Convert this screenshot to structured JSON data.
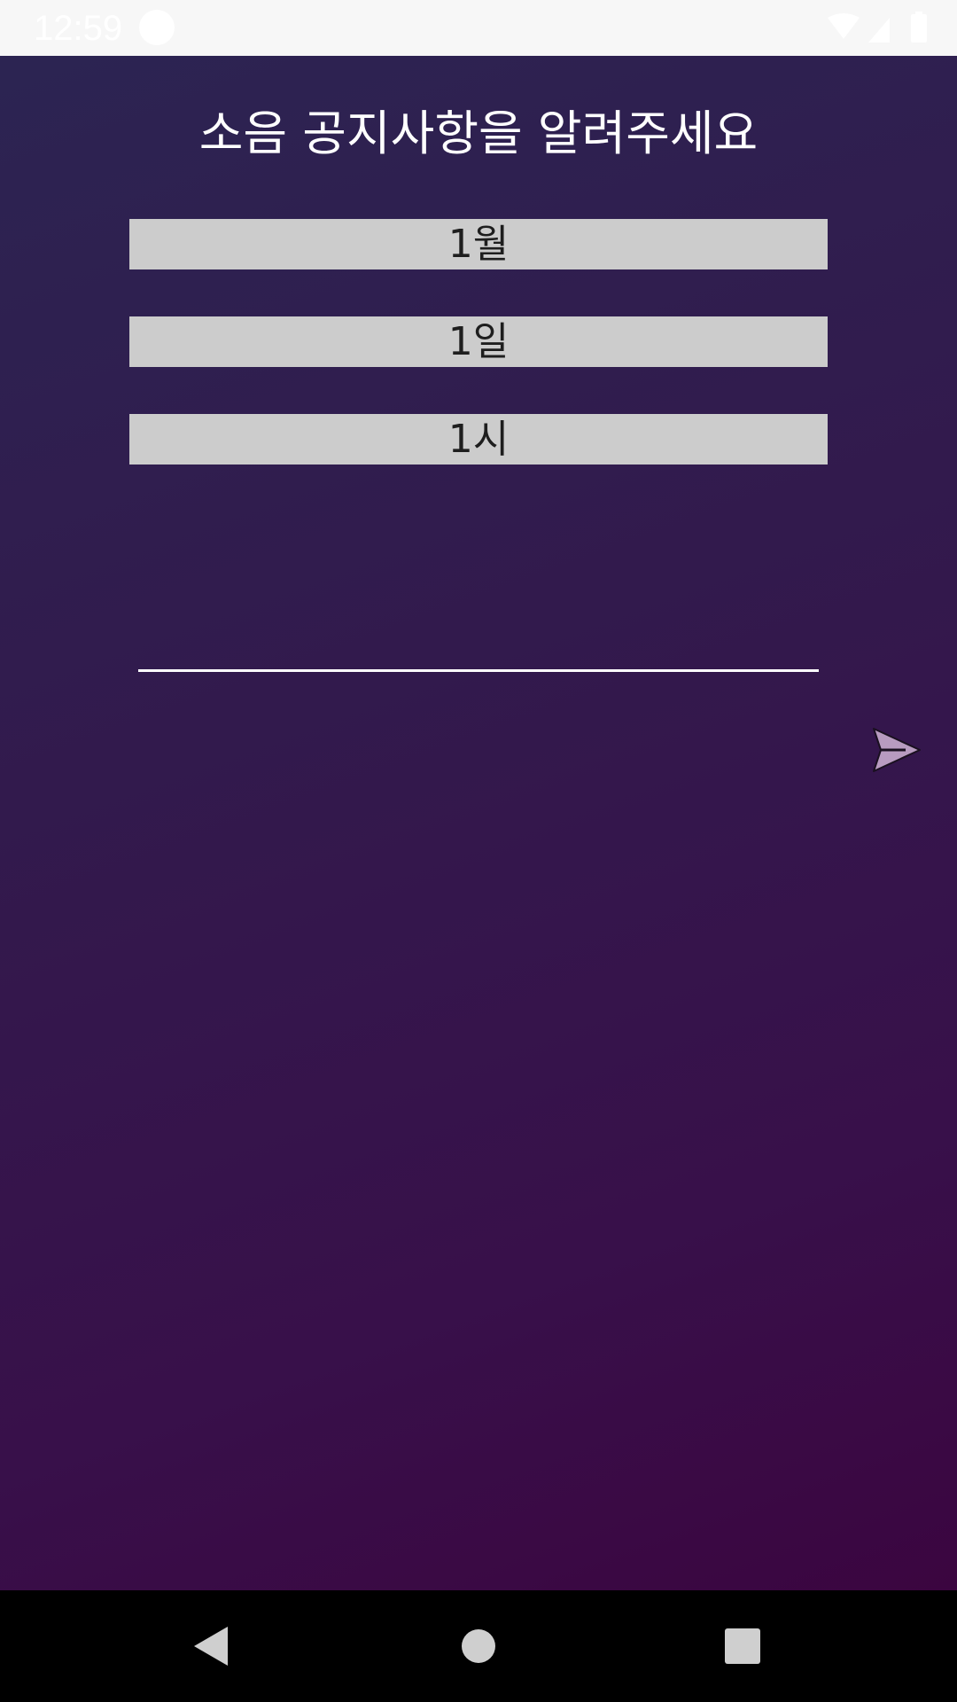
{
  "status_bar": {
    "time": "12:59",
    "icons": [
      "wifi-icon",
      "cell-signal-icon",
      "battery-icon"
    ]
  },
  "screen": {
    "title": "소음 공지사항을 알려주세요",
    "month_picker": "1월",
    "day_picker": "1일",
    "hour_picker": "1시",
    "memo_input": {
      "value": "",
      "placeholder": ""
    },
    "send_icon": "send-icon"
  },
  "nav_bar": {
    "icons": [
      "back-icon",
      "home-icon",
      "recents-icon"
    ]
  },
  "colors": {
    "background_top": "#2c2452",
    "background_bottom": "#3b0540",
    "picker_bg": "#cccccc",
    "title_text": "#ffffff",
    "send_icon_fill": "#b89bc0"
  }
}
